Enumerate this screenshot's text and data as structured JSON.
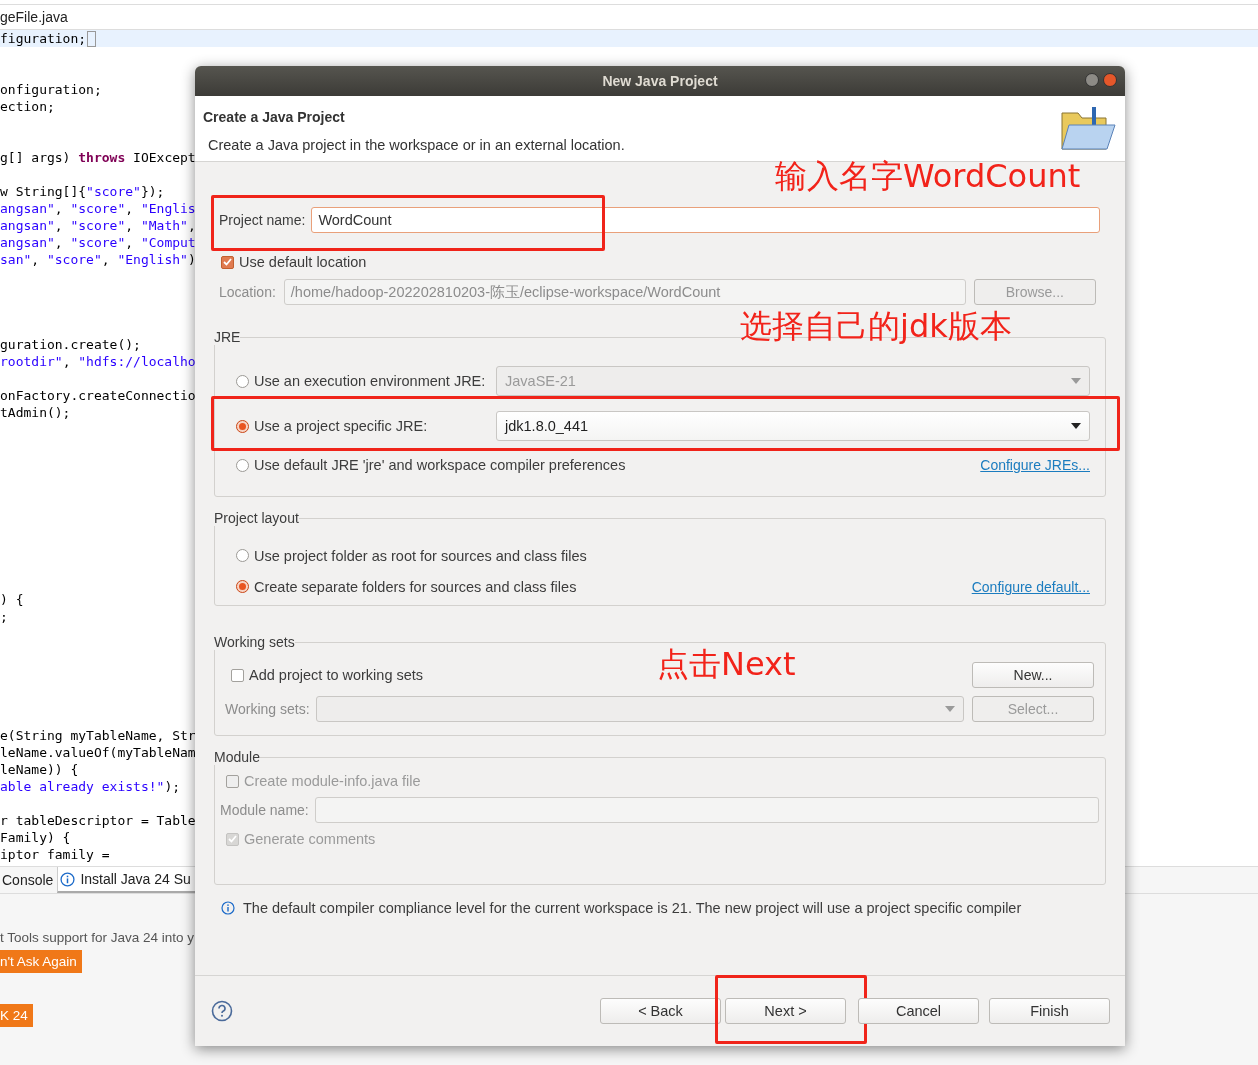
{
  "editor": {
    "file_tab": "geFile.java",
    "current_line": "figuration;",
    "lines": [
      {
        "segments": [
          {
            "text": "onfiguration;",
            "kind": "code"
          }
        ]
      },
      {
        "segments": [
          {
            "text": "ection;",
            "kind": "code"
          }
        ]
      },
      {
        "kind": "blank"
      },
      {
        "kind": "blank"
      },
      {
        "segments": [
          {
            "text": "g[] args) ",
            "kind": "code"
          },
          {
            "text": "throws",
            "kind": "keyword"
          },
          {
            "text": " IOExcept",
            "kind": "code"
          }
        ]
      },
      {
        "kind": "blank"
      },
      {
        "segments": [
          {
            "text": "w String[]{",
            "kind": "code"
          },
          {
            "text": "\"score\"",
            "kind": "string"
          },
          {
            "text": "});",
            "kind": "code"
          }
        ]
      },
      {
        "segments": [
          {
            "text": "angsan\"",
            "kind": "string"
          },
          {
            "text": ", ",
            "kind": "code"
          },
          {
            "text": "\"score\"",
            "kind": "string"
          },
          {
            "text": ", ",
            "kind": "code"
          },
          {
            "text": "\"Englis",
            "kind": "string"
          }
        ]
      },
      {
        "segments": [
          {
            "text": "angsan\"",
            "kind": "string"
          },
          {
            "text": ", ",
            "kind": "code"
          },
          {
            "text": "\"score\"",
            "kind": "string"
          },
          {
            "text": ", ",
            "kind": "code"
          },
          {
            "text": "\"Math\"",
            "kind": "string"
          },
          {
            "text": ",",
            "kind": "code"
          }
        ]
      },
      {
        "segments": [
          {
            "text": "angsan\"",
            "kind": "string"
          },
          {
            "text": ", ",
            "kind": "code"
          },
          {
            "text": "\"score\"",
            "kind": "string"
          },
          {
            "text": ", ",
            "kind": "code"
          },
          {
            "text": "\"Comput",
            "kind": "string"
          }
        ]
      },
      {
        "segments": [
          {
            "text": "san\"",
            "kind": "string"
          },
          {
            "text": ", ",
            "kind": "code"
          },
          {
            "text": "\"score\"",
            "kind": "string"
          },
          {
            "text": ", ",
            "kind": "code"
          },
          {
            "text": "\"English\"",
            "kind": "string"
          },
          {
            "text": ")",
            "kind": "code"
          }
        ]
      },
      {
        "kind": "blank"
      },
      {
        "kind": "blank"
      },
      {
        "kind": "blank"
      },
      {
        "kind": "blank"
      },
      {
        "segments": [
          {
            "text": "guration.create();",
            "kind": "code"
          }
        ]
      },
      {
        "segments": [
          {
            "text": "rootdir\"",
            "kind": "string"
          },
          {
            "text": ", ",
            "kind": "code"
          },
          {
            "text": "\"hdfs://localho",
            "kind": "string"
          }
        ]
      },
      {
        "kind": "blank"
      },
      {
        "segments": [
          {
            "text": "onFactory.createConnectio",
            "kind": "code"
          }
        ]
      },
      {
        "segments": [
          {
            "text": "tAdmin();",
            "kind": "code"
          }
        ]
      },
      {
        "kind": "blank"
      },
      {
        "kind": "blank"
      },
      {
        "kind": "blank"
      },
      {
        "kind": "blank"
      },
      {
        "kind": "blank"
      },
      {
        "kind": "blank"
      },
      {
        "kind": "blank"
      },
      {
        "kind": "blank"
      },
      {
        "kind": "blank"
      },
      {
        "kind": "blank"
      },
      {
        "segments": [
          {
            "text": ") {",
            "kind": "code"
          }
        ]
      },
      {
        "segments": [
          {
            "text": ";",
            "kind": "code"
          }
        ]
      },
      {
        "kind": "blank"
      },
      {
        "kind": "blank"
      },
      {
        "kind": "blank"
      },
      {
        "kind": "blank"
      },
      {
        "kind": "blank"
      },
      {
        "kind": "blank"
      },
      {
        "segments": [
          {
            "text": "e(String myTableName, Str",
            "kind": "code"
          }
        ]
      },
      {
        "segments": [
          {
            "text": "leName.valueOf(myTableNam",
            "kind": "code"
          }
        ]
      },
      {
        "segments": [
          {
            "text": "leName)) {",
            "kind": "code"
          }
        ]
      },
      {
        "segments": [
          {
            "text": "able already exists!\"",
            "kind": "string"
          },
          {
            "text": ");",
            "kind": "code"
          }
        ]
      },
      {
        "kind": "blank"
      },
      {
        "segments": [
          {
            "text": "r tableDescriptor = Table",
            "kind": "code"
          }
        ]
      },
      {
        "segments": [
          {
            "text": "Family) {",
            "kind": "code"
          }
        ]
      },
      {
        "segments": [
          {
            "text": "iptor family =",
            "kind": "code"
          }
        ]
      }
    ]
  },
  "bottom_panel": {
    "tabs": [
      {
        "label": "Console",
        "selected": false
      },
      {
        "label": "Install Java 24 Su",
        "selected": true
      }
    ],
    "message": "t Tools support for Java 24 into y",
    "buttons": [
      "n't Ask Again",
      "K 24"
    ]
  },
  "dialog": {
    "title": "New Java Project",
    "header": {
      "title": "Create a Java Project",
      "description": "Create a Java project in the workspace or in an external location."
    },
    "project_name": {
      "label": "Project name:",
      "value": "WordCount",
      "highlighted": true
    },
    "default_location": {
      "label": "Use default location",
      "checked": true
    },
    "location": {
      "label": "Location:",
      "value": "/home/hadoop-202202810203-陈玉/eclipse-workspace/WordCount",
      "disabled": true,
      "browse": "Browse..."
    },
    "jre": {
      "legend": "JRE",
      "options": [
        {
          "label": "Use an execution environment JRE:",
          "selected": false,
          "combo": "JavaSE-21",
          "disabled": true,
          "highlighted": false
        },
        {
          "label": "Use a project specific JRE:",
          "selected": true,
          "combo": "jdk1.8.0_441",
          "disabled": false,
          "highlighted": true
        },
        {
          "label": "Use default JRE 'jre' and workspace compiler preferences",
          "selected": false,
          "link": "Configure JREs..."
        }
      ]
    },
    "project_layout": {
      "legend": "Project layout",
      "options": [
        {
          "label": "Use project folder as root for sources and class files",
          "selected": false
        },
        {
          "label": "Create separate folders for sources and class files",
          "selected": true,
          "link": "Configure default..."
        }
      ]
    },
    "working_sets": {
      "legend": "Working sets",
      "add": {
        "label": "Add project to working sets",
        "checked": false
      },
      "new_button": "New...",
      "sets_label": "Working sets:",
      "select_button": "Select...",
      "disabled": true
    },
    "module": {
      "legend": "Module",
      "create": {
        "label": "Create module-info.java file",
        "checked": false
      },
      "name_label": "Module name:",
      "comments": {
        "label": "Generate comments",
        "checked": true
      },
      "disabled": true
    },
    "info": "The default compiler compliance level for the current workspace is 21. The new project will use a project specific compiler",
    "buttons": [
      {
        "label": "< Back",
        "highlighted": false
      },
      {
        "label": "Next >",
        "highlighted": true
      },
      {
        "label": "Cancel",
        "highlighted": false
      },
      {
        "label": "Finish",
        "highlighted": false
      }
    ]
  },
  "annotations": [
    "输入名字WordCount",
    "选择自己的jdk版本",
    "点击Next"
  ]
}
